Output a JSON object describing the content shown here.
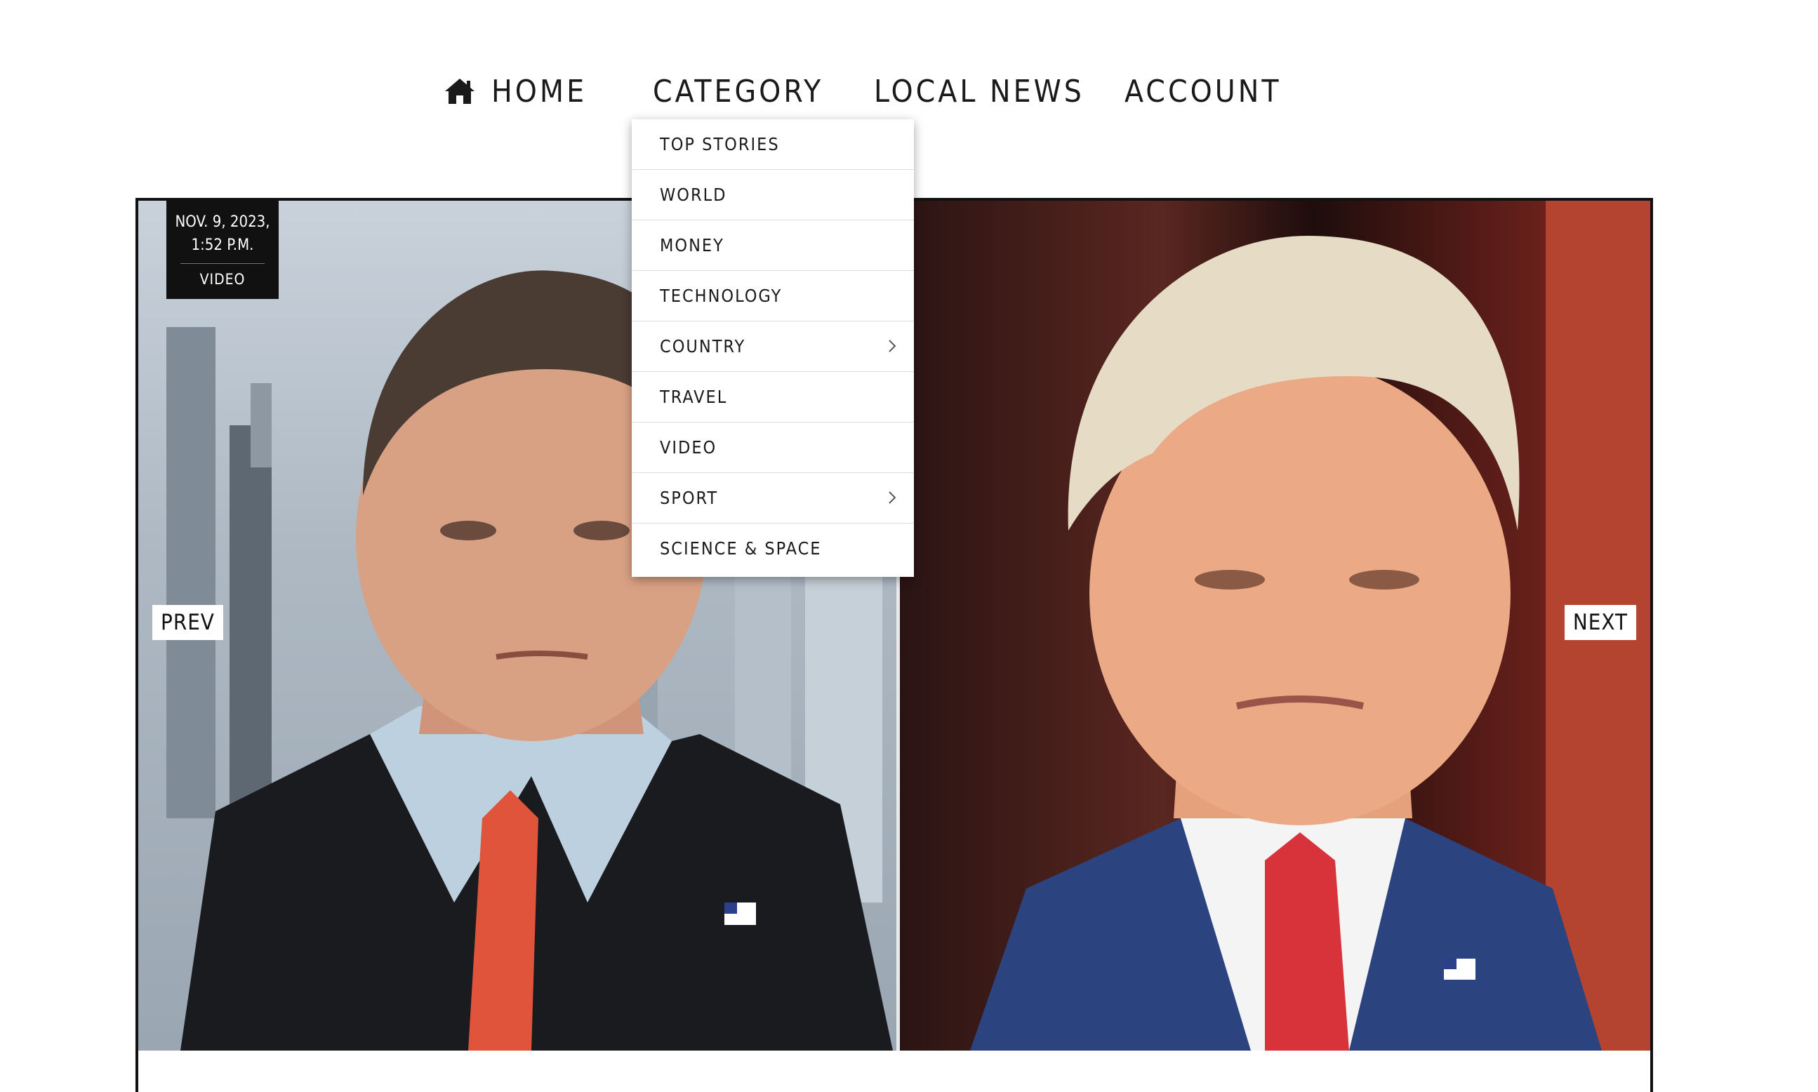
{
  "nav": {
    "home": "HOME",
    "category": "CATEGORY",
    "local_news": "LOCAL NEWS",
    "account": "ACCOUNT"
  },
  "hero": {
    "date_line1": "NOV. 9, 2023,",
    "date_line2": "1:52 P.M.",
    "tag": "VIDEO",
    "prev": "PREV",
    "next": "NEXT"
  },
  "dropdown": {
    "items": [
      {
        "label": "TOP STORIES"
      },
      {
        "label": "WORLD"
      },
      {
        "label": "MONEY"
      },
      {
        "label": "TECHNOLOGY"
      },
      {
        "label": "COUNTRY",
        "has_submenu": true
      },
      {
        "label": "TRAVEL"
      },
      {
        "label": "VIDEO"
      },
      {
        "label": "SPORT",
        "has_submenu": true
      },
      {
        "label": "SCIENCE & SPACE"
      }
    ]
  },
  "colors": {
    "text": "#1a1a1a",
    "badge_bg": "#111111",
    "border": "#111111"
  }
}
